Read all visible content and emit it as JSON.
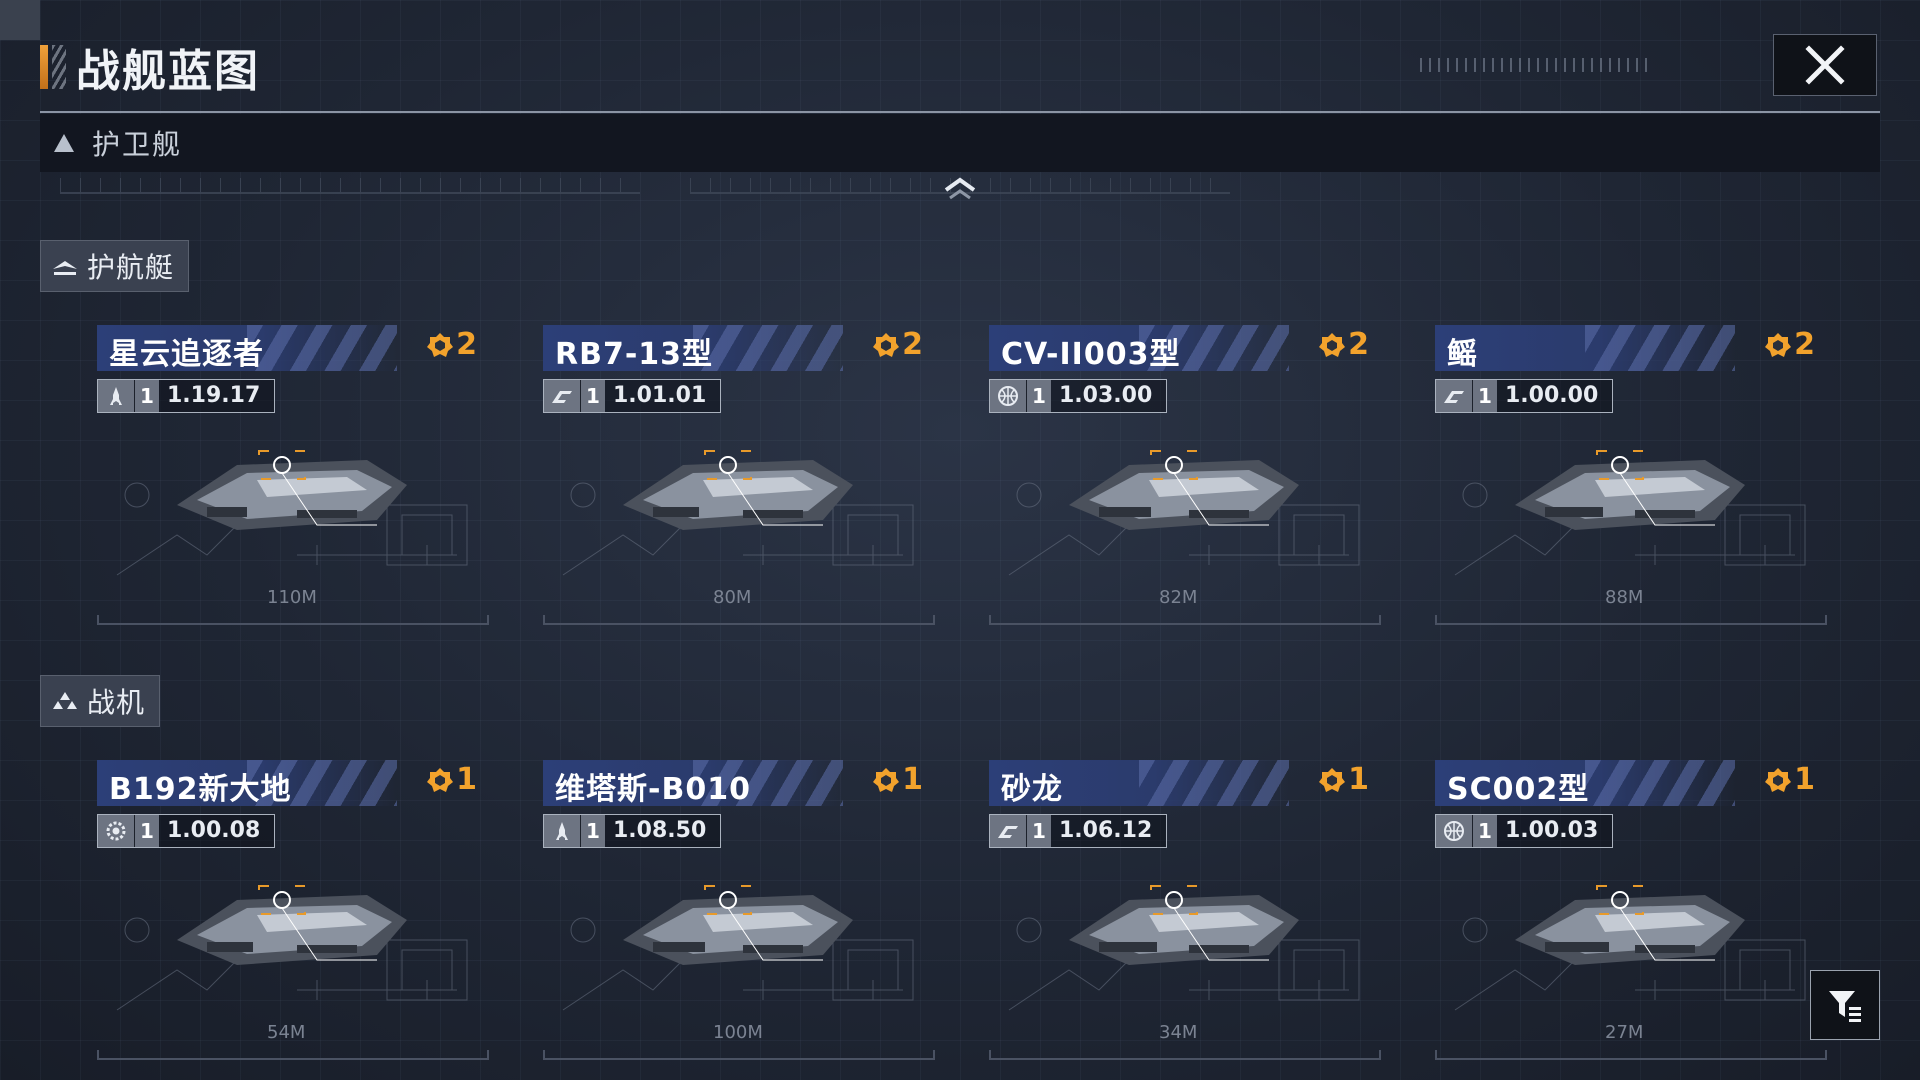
{
  "header": {
    "title": "战舰蓝图"
  },
  "category": {
    "label": "护卫舰"
  },
  "sections": [
    {
      "label": "护航艇",
      "cards": [
        {
          "name": "星云追逐者",
          "rank": "2",
          "level": "1",
          "version": "1.19.17",
          "size": "110M",
          "icon": "rocket-icon"
        },
        {
          "name": "RB7-13型",
          "rank": "2",
          "level": "1",
          "version": "1.01.01",
          "size": "80M",
          "icon": "wing-logo-icon"
        },
        {
          "name": "CV-II003型",
          "rank": "2",
          "level": "1",
          "version": "1.03.00",
          "size": "82M",
          "icon": "globe-icon"
        },
        {
          "name": "鳐",
          "rank": "2",
          "level": "1",
          "version": "1.00.00",
          "size": "88M",
          "icon": "wing-logo-icon"
        }
      ]
    },
    {
      "label": "战机",
      "cards": [
        {
          "name": "B192新大地",
          "rank": "1",
          "level": "1",
          "version": "1.00.08",
          "size": "54M",
          "icon": "gear-logo-icon"
        },
        {
          "name": "维塔斯-B010",
          "rank": "1",
          "level": "1",
          "version": "1.08.50",
          "size": "100M",
          "icon": "rocket-icon"
        },
        {
          "name": "砂龙",
          "rank": "1",
          "level": "1",
          "version": "1.06.12",
          "size": "34M",
          "icon": "wing-logo-icon"
        },
        {
          "name": "SC002型",
          "rank": "1",
          "level": "1",
          "version": "1.00.03",
          "size": "27M",
          "icon": "globe-icon"
        }
      ]
    }
  ],
  "colors": {
    "accent": "#f2a22c",
    "name_bar": "#2c3f78",
    "background": "#1f2634"
  }
}
